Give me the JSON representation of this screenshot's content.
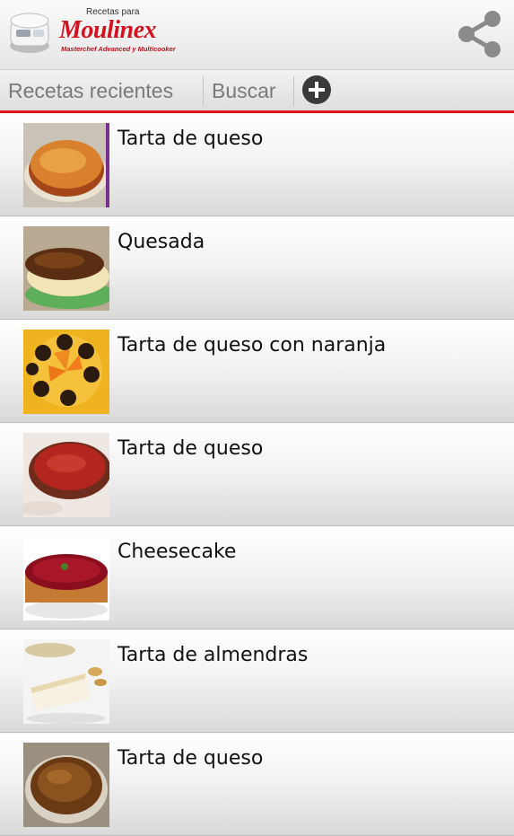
{
  "header": {
    "logo_small": "Recetas para",
    "logo_brand": "Moulinex",
    "logo_tagline": "Masterchef Advanced y Multicooker",
    "share_icon": "share-icon",
    "app_icon": "cooker-icon"
  },
  "tabs": [
    {
      "label": "Recetas recientes"
    },
    {
      "label": "Buscar"
    }
  ],
  "add_icon": "plus-circle-icon",
  "accent_color": "#e3161e",
  "recipes": [
    {
      "title": "Tarta de queso",
      "thumb": "thumb-baked-cheesecake"
    },
    {
      "title": "Quesada",
      "thumb": "thumb-quesada"
    },
    {
      "title": "Tarta de queso con naranja",
      "thumb": "thumb-orange-cheesecake"
    },
    {
      "title": "Tarta de queso",
      "thumb": "thumb-red-cheesecake"
    },
    {
      "title": "Cheesecake",
      "thumb": "thumb-berry-cheesecake"
    },
    {
      "title": "Tarta de almendras",
      "thumb": "thumb-almond-cake"
    },
    {
      "title": "Tarta de queso",
      "thumb": "thumb-caramel-cheesecake"
    }
  ]
}
